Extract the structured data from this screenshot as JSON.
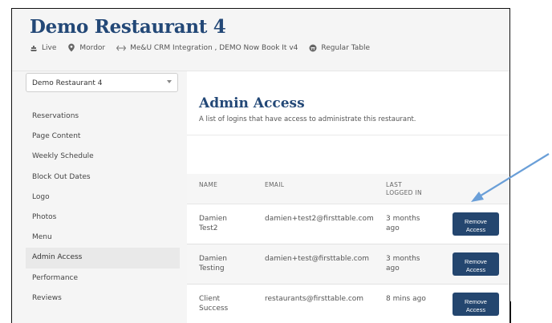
{
  "restaurant": {
    "name": "Demo Restaurant 4",
    "meta": [
      {
        "icon": "ship-icon",
        "label": "Live"
      },
      {
        "icon": "location-pin-icon",
        "label": "Mordor"
      },
      {
        "icon": "arrows-icon",
        "label": "Me&U CRM Integration , DEMO Now Book It v4"
      },
      {
        "icon": "table-icon",
        "label": "Regular Table"
      }
    ]
  },
  "sidebar": {
    "select_value": "Demo Restaurant 4",
    "items": [
      {
        "label": "Reservations"
      },
      {
        "label": "Page Content"
      },
      {
        "label": "Weekly Schedule"
      },
      {
        "label": "Block Out Dates"
      },
      {
        "label": "Logo"
      },
      {
        "label": "Photos"
      },
      {
        "label": "Menu"
      },
      {
        "label": "Admin Access",
        "active": true
      },
      {
        "label": "Performance"
      },
      {
        "label": "Reviews"
      }
    ]
  },
  "page": {
    "title": "Admin Access",
    "subtitle": "A list of logins that have access to administrate this restaurant."
  },
  "table": {
    "headers": {
      "name": "NAME",
      "email": "EMAIL",
      "last": "LAST\nLOGGED IN"
    },
    "rows": [
      {
        "name": "Damien\nTest2",
        "email": "damien+test2@firsttable.com",
        "last": "3 months\nago",
        "action": "Remove\nAccess"
      },
      {
        "name": "Damien\nTesting",
        "email": "damien+test@firsttable.com",
        "last": "3 months\nago",
        "action": "Remove\nAccess"
      },
      {
        "name": "Client\nSuccess",
        "email": "restaurants@firsttable.com",
        "last": "8 mins ago",
        "action": "Remove\nAccess"
      }
    ]
  },
  "colors": {
    "brand": "#234877",
    "button": "#24466f",
    "annotation_arrow": "#6a9fd8"
  }
}
